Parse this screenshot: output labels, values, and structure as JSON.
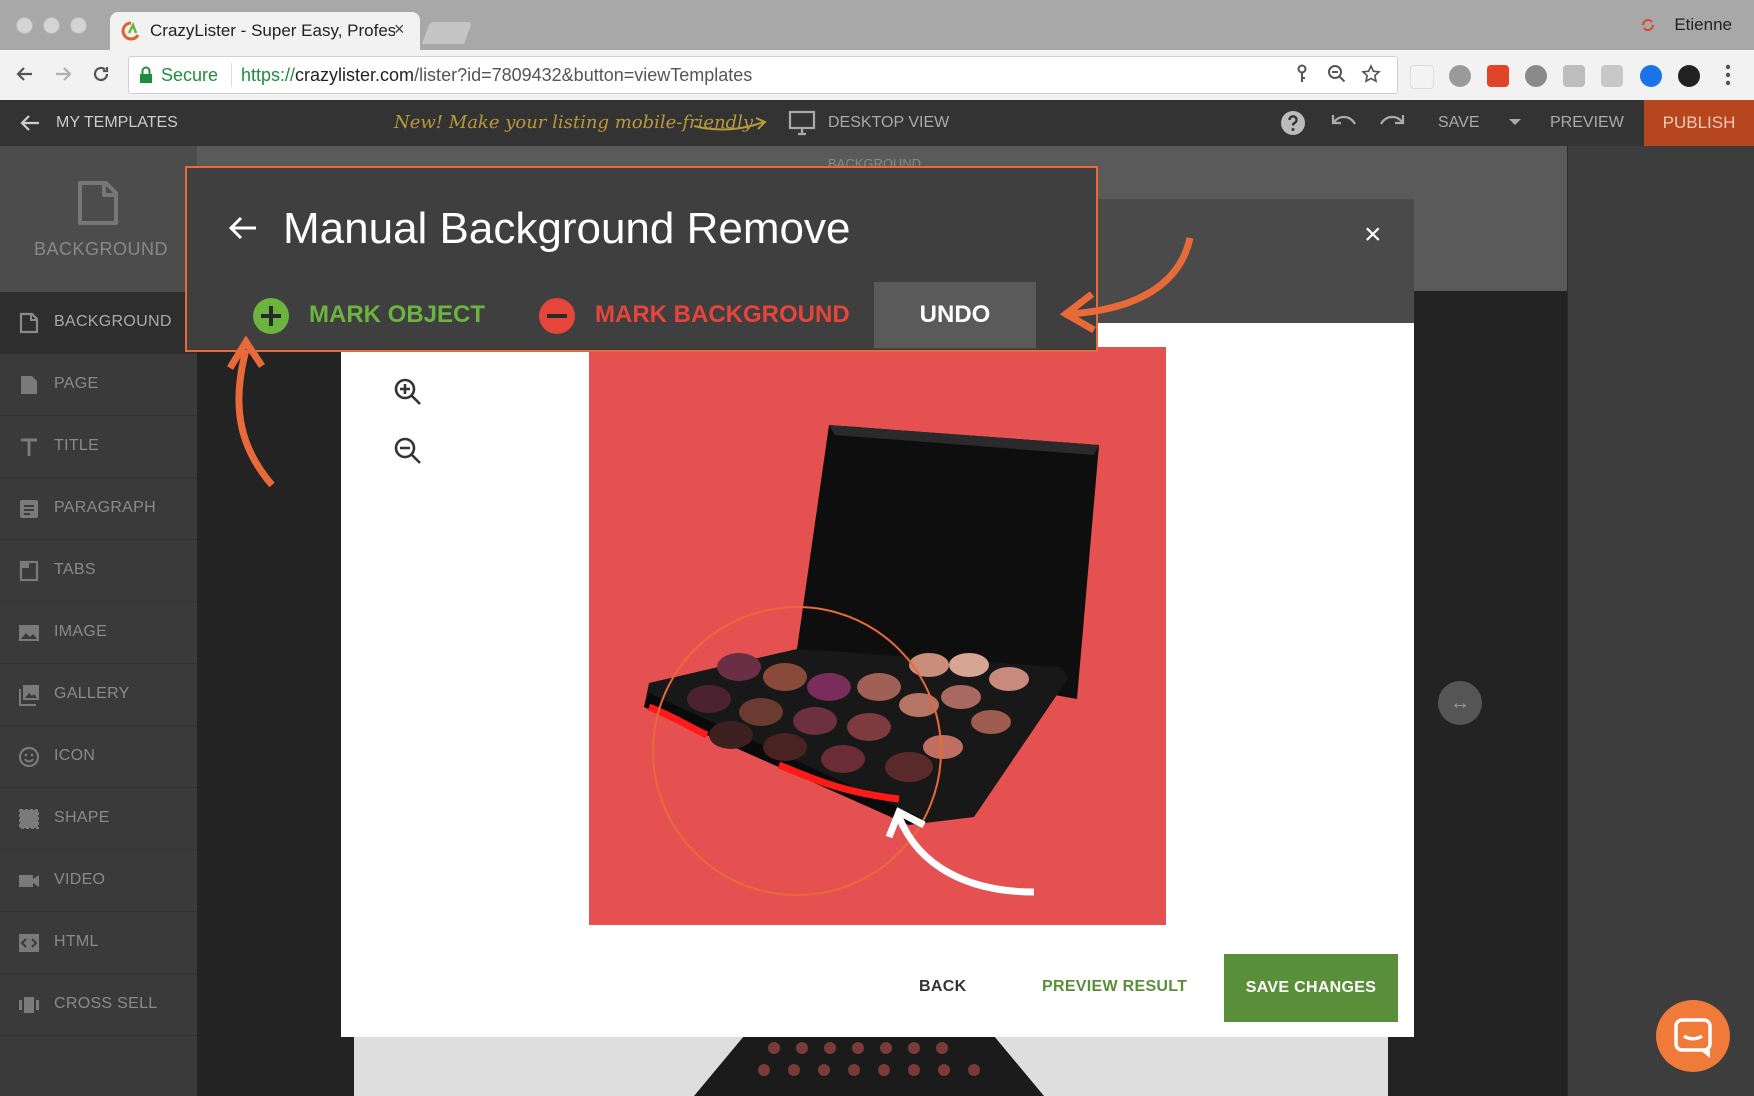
{
  "browser": {
    "tab_title": "CrazyLister - Super Easy, Professional",
    "tab_close": "×",
    "user": "Etienne",
    "secure_label": "Secure",
    "url_protocol": "https://",
    "url_host": "crazylister.com",
    "url_path": "/lister?id=7809432&button=viewTemplates"
  },
  "toolbar": {
    "back_label": "MY TEMPLATES",
    "promo": "New! Make your listing mobile-friendly",
    "view_label": "DESKTOP VIEW",
    "save_label": "SAVE",
    "preview_label": "PREVIEW",
    "publish_label": "PUBLISH",
    "faded_label": "BACKGROUND"
  },
  "sidebar": {
    "header_label": "BACKGROUND",
    "items": [
      {
        "label": "BACKGROUND",
        "icon": "background-icon"
      },
      {
        "label": "PAGE",
        "icon": "page-icon"
      },
      {
        "label": "TITLE",
        "icon": "title-icon"
      },
      {
        "label": "PARAGRAPH",
        "icon": "paragraph-icon"
      },
      {
        "label": "TABS",
        "icon": "tabs-icon"
      },
      {
        "label": "IMAGE",
        "icon": "image-icon"
      },
      {
        "label": "GALLERY",
        "icon": "gallery-icon"
      },
      {
        "label": "ICON",
        "icon": "smiley-icon"
      },
      {
        "label": "SHAPE",
        "icon": "shape-icon"
      },
      {
        "label": "VIDEO",
        "icon": "video-icon"
      },
      {
        "label": "HTML",
        "icon": "html-icon"
      },
      {
        "label": "CROSS SELL",
        "icon": "cross-sell-icon"
      }
    ]
  },
  "panel": {
    "title": "Manual Background Remove",
    "mark_object": "MARK OBJECT",
    "mark_background": "MARK BACKGROUND",
    "undo": "UNDO"
  },
  "modal": {
    "close": "×",
    "back": "BACK",
    "preview_result": "PREVIEW RESULT",
    "save_changes": "SAVE CHANGES"
  },
  "colors": {
    "accent_green": "#5a8f3a",
    "mark_red": "#e5453a",
    "annotation_orange": "#e86a38",
    "photo_red": "#e55151"
  }
}
